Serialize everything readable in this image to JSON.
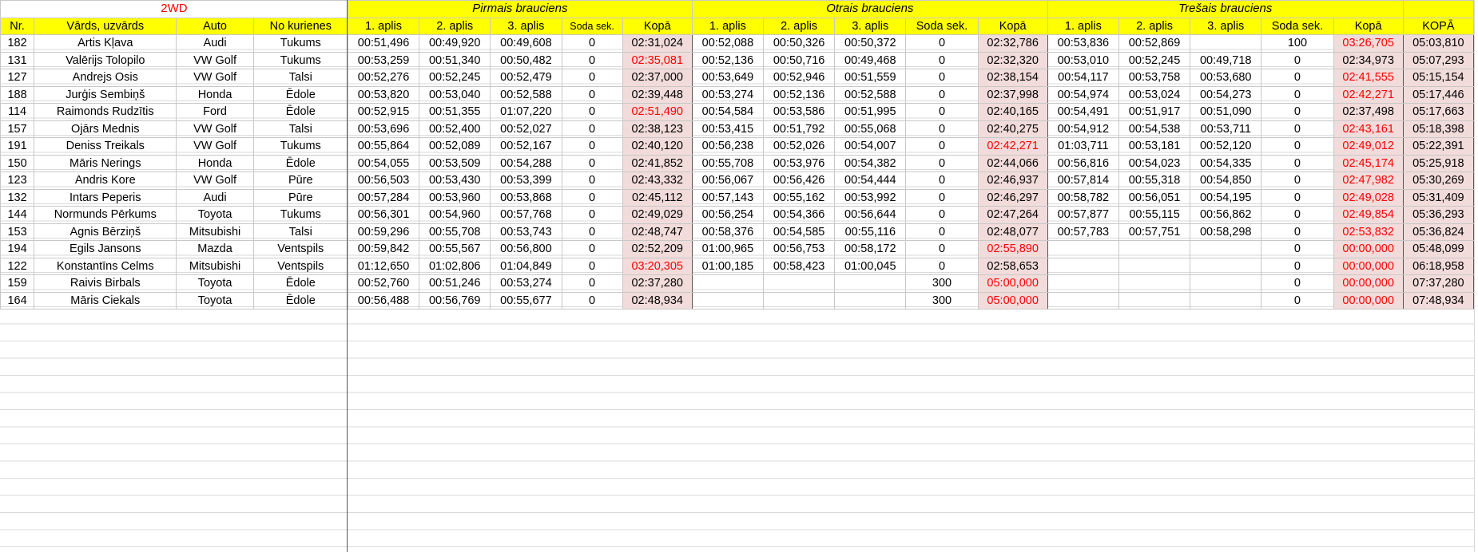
{
  "sheet_title": "2WD",
  "heats": [
    "Pirmais brauciens",
    "Otrais brauciens",
    "Trešais brauciens"
  ],
  "headers": {
    "nr": "Nr.",
    "name": "Vārds, uzvārds",
    "car": "Auto",
    "from": "No kurienes",
    "lap1": "1. aplis",
    "lap2": "2. aplis",
    "lap3": "3. aplis",
    "penalty": "Soda sek.",
    "total": "Kopā",
    "grand_total": "KOPĀ"
  },
  "rows": [
    {
      "nr": "182",
      "name": "Artis Kļava",
      "car": "Audi",
      "from": "Tukums",
      "h1": {
        "l1": "00:51,496",
        "l2": "00:49,920",
        "l3": "00:49,608",
        "pen": "0",
        "tot": "02:31,024"
      },
      "h2": {
        "l1": "00:52,088",
        "l2": "00:50,326",
        "l3": "00:50,372",
        "pen": "0",
        "tot": "02:32,786"
      },
      "h3": {
        "l1": "00:53,836",
        "l2": "00:52,869",
        "l3": "",
        "pen": "100",
        "tot": "03:26,705"
      },
      "grand": "05:03,810"
    },
    {
      "nr": "131",
      "name": "Valērijs Tolopilo",
      "car": "VW Golf",
      "from": "Tukums",
      "h1": {
        "l1": "00:53,259",
        "l2": "00:51,340",
        "l3": "00:50,482",
        "pen": "0",
        "tot": "02:35,081"
      },
      "h2": {
        "l1": "00:52,136",
        "l2": "00:50,716",
        "l3": "00:49,468",
        "pen": "0",
        "tot": "02:32,320"
      },
      "h3": {
        "l1": "00:53,010",
        "l2": "00:52,245",
        "l3": "00:49,718",
        "pen": "0",
        "tot": "02:34,973"
      },
      "grand": "05:07,293"
    },
    {
      "nr": "127",
      "name": "Andrejs Osis",
      "car": "VW Golf",
      "from": "Talsi",
      "h1": {
        "l1": "00:52,276",
        "l2": "00:52,245",
        "l3": "00:52,479",
        "pen": "0",
        "tot": "02:37,000"
      },
      "h2": {
        "l1": "00:53,649",
        "l2": "00:52,946",
        "l3": "00:51,559",
        "pen": "0",
        "tot": "02:38,154"
      },
      "h3": {
        "l1": "00:54,117",
        "l2": "00:53,758",
        "l3": "00:53,680",
        "pen": "0",
        "tot": "02:41,555"
      },
      "grand": "05:15,154"
    },
    {
      "nr": "188",
      "name": "Jurģis Sembiņš",
      "car": "Honda",
      "from": "Ēdole",
      "h1": {
        "l1": "00:53,820",
        "l2": "00:53,040",
        "l3": "00:52,588",
        "pen": "0",
        "tot": "02:39,448"
      },
      "h2": {
        "l1": "00:53,274",
        "l2": "00:52,136",
        "l3": "00:52,588",
        "pen": "0",
        "tot": "02:37,998"
      },
      "h3": {
        "l1": "00:54,974",
        "l2": "00:53,024",
        "l3": "00:54,273",
        "pen": "0",
        "tot": "02:42,271"
      },
      "grand": "05:17,446"
    },
    {
      "nr": "114",
      "name": "Raimonds Rudzītis",
      "car": "Ford",
      "from": "Ēdole",
      "h1": {
        "l1": "00:52,915",
        "l2": "00:51,355",
        "l3": "01:07,220",
        "pen": "0",
        "tot": "02:51,490"
      },
      "h2": {
        "l1": "00:54,584",
        "l2": "00:53,586",
        "l3": "00:51,995",
        "pen": "0",
        "tot": "02:40,165"
      },
      "h3": {
        "l1": "00:54,491",
        "l2": "00:51,917",
        "l3": "00:51,090",
        "pen": "0",
        "tot": "02:37,498"
      },
      "grand": "05:17,663"
    },
    {
      "nr": "157",
      "name": "Ojārs Mednis",
      "car": "VW Golf",
      "from": "Talsi",
      "h1": {
        "l1": "00:53,696",
        "l2": "00:52,400",
        "l3": "00:52,027",
        "pen": "0",
        "tot": "02:38,123"
      },
      "h2": {
        "l1": "00:53,415",
        "l2": "00:51,792",
        "l3": "00:55,068",
        "pen": "0",
        "tot": "02:40,275"
      },
      "h3": {
        "l1": "00:54,912",
        "l2": "00:54,538",
        "l3": "00:53,711",
        "pen": "0",
        "tot": "02:43,161"
      },
      "grand": "05:18,398"
    },
    {
      "nr": "191",
      "name": "Deniss Treikals",
      "car": "VW Golf",
      "from": "Tukums",
      "h1": {
        "l1": "00:55,864",
        "l2": "00:52,089",
        "l3": "00:52,167",
        "pen": "0",
        "tot": "02:40,120"
      },
      "h2": {
        "l1": "00:56,238",
        "l2": "00:52,026",
        "l3": "00:54,007",
        "pen": "0",
        "tot": "02:42,271"
      },
      "h3": {
        "l1": "01:03,711",
        "l2": "00:53,181",
        "l3": "00:52,120",
        "pen": "0",
        "tot": "02:49,012"
      },
      "grand": "05:22,391"
    },
    {
      "nr": "150",
      "name": "Māris Nerings",
      "car": "Honda",
      "from": "Ēdole",
      "h1": {
        "l1": "00:54,055",
        "l2": "00:53,509",
        "l3": "00:54,288",
        "pen": "0",
        "tot": "02:41,852"
      },
      "h2": {
        "l1": "00:55,708",
        "l2": "00:53,976",
        "l3": "00:54,382",
        "pen": "0",
        "tot": "02:44,066"
      },
      "h3": {
        "l1": "00:56,816",
        "l2": "00:54,023",
        "l3": "00:54,335",
        "pen": "0",
        "tot": "02:45,174"
      },
      "grand": "05:25,918"
    },
    {
      "nr": "123",
      "name": "Andris Kore",
      "car": "VW Golf",
      "from": "Pūre",
      "h1": {
        "l1": "00:56,503",
        "l2": "00:53,430",
        "l3": "00:53,399",
        "pen": "0",
        "tot": "02:43,332"
      },
      "h2": {
        "l1": "00:56,067",
        "l2": "00:56,426",
        "l3": "00:54,444",
        "pen": "0",
        "tot": "02:46,937"
      },
      "h3": {
        "l1": "00:57,814",
        "l2": "00:55,318",
        "l3": "00:54,850",
        "pen": "0",
        "tot": "02:47,982"
      },
      "grand": "05:30,269"
    },
    {
      "nr": "132",
      "name": "Intars Peperis",
      "car": "Audi",
      "from": "Pūre",
      "h1": {
        "l1": "00:57,284",
        "l2": "00:53,960",
        "l3": "00:53,868",
        "pen": "0",
        "tot": "02:45,112"
      },
      "h2": {
        "l1": "00:57,143",
        "l2": "00:55,162",
        "l3": "00:53,992",
        "pen": "0",
        "tot": "02:46,297"
      },
      "h3": {
        "l1": "00:58,782",
        "l2": "00:56,051",
        "l3": "00:54,195",
        "pen": "0",
        "tot": "02:49,028"
      },
      "grand": "05:31,409"
    },
    {
      "nr": "144",
      "name": "Normunds Pērkums",
      "car": "Toyota",
      "from": "Tukums",
      "h1": {
        "l1": "00:56,301",
        "l2": "00:54,960",
        "l3": "00:57,768",
        "pen": "0",
        "tot": "02:49,029"
      },
      "h2": {
        "l1": "00:56,254",
        "l2": "00:54,366",
        "l3": "00:56,644",
        "pen": "0",
        "tot": "02:47,264"
      },
      "h3": {
        "l1": "00:57,877",
        "l2": "00:55,115",
        "l3": "00:56,862",
        "pen": "0",
        "tot": "02:49,854"
      },
      "grand": "05:36,293"
    },
    {
      "nr": "153",
      "name": "Agnis Bērziņš",
      "car": "Mitsubishi",
      "from": "Talsi",
      "h1": {
        "l1": "00:59,296",
        "l2": "00:55,708",
        "l3": "00:53,743",
        "pen": "0",
        "tot": "02:48,747"
      },
      "h2": {
        "l1": "00:58,376",
        "l2": "00:54,585",
        "l3": "00:55,116",
        "pen": "0",
        "tot": "02:48,077"
      },
      "h3": {
        "l1": "00:57,783",
        "l2": "00:57,751",
        "l3": "00:58,298",
        "pen": "0",
        "tot": "02:53,832"
      },
      "grand": "05:36,824"
    },
    {
      "nr": "194",
      "name": "Egils Jansons",
      "car": "Mazda",
      "from": "Ventspils",
      "h1": {
        "l1": "00:59,842",
        "l2": "00:55,567",
        "l3": "00:56,800",
        "pen": "0",
        "tot": "02:52,209"
      },
      "h2": {
        "l1": "01:00,965",
        "l2": "00:56,753",
        "l3": "00:58,172",
        "pen": "0",
        "tot": "02:55,890"
      },
      "h3": {
        "l1": "",
        "l2": "",
        "l3": "",
        "pen": "0",
        "tot": "00:00,000"
      },
      "grand": "05:48,099"
    },
    {
      "nr": "122",
      "name": "Konstantīns Celms",
      "car": "Mitsubishi",
      "from": "Ventspils",
      "h1": {
        "l1": "01:12,650",
        "l2": "01:02,806",
        "l3": "01:04,849",
        "pen": "0",
        "tot": "03:20,305"
      },
      "h2": {
        "l1": "01:00,185",
        "l2": "00:58,423",
        "l3": "01:00,045",
        "pen": "0",
        "tot": "02:58,653"
      },
      "h3": {
        "l1": "",
        "l2": "",
        "l3": "",
        "pen": "0",
        "tot": "00:00,000"
      },
      "grand": "06:18,958"
    },
    {
      "nr": "159",
      "name": "Raivis Birbals",
      "car": "Toyota",
      "from": "Ēdole",
      "h1": {
        "l1": "00:52,760",
        "l2": "00:51,246",
        "l3": "00:53,274",
        "pen": "0",
        "tot": "02:37,280"
      },
      "h2": {
        "l1": "",
        "l2": "",
        "l3": "",
        "pen": "300",
        "tot": "05:00,000"
      },
      "h3": {
        "l1": "",
        "l2": "",
        "l3": "",
        "pen": "0",
        "tot": "00:00,000"
      },
      "grand": "07:37,280"
    },
    {
      "nr": "164",
      "name": "Māris Ciekals",
      "car": "Toyota",
      "from": "Ēdole",
      "h1": {
        "l1": "00:56,488",
        "l2": "00:56,769",
        "l3": "00:55,677",
        "pen": "0",
        "tot": "02:48,934"
      },
      "h2": {
        "l1": "",
        "l2": "",
        "l3": "",
        "pen": "300",
        "tot": "05:00,000"
      },
      "h3": {
        "l1": "",
        "l2": "",
        "l3": "",
        "pen": "0",
        "tot": "00:00,000"
      },
      "grand": "07:48,934"
    }
  ],
  "highlights": {
    "best_lap": [
      [
        "l3",
        "l2",
        "l2"
      ],
      [
        "l3",
        "l3",
        "l3"
      ],
      [
        "l2",
        "l3",
        "l3"
      ],
      [
        "l3",
        "l2",
        "l2"
      ],
      [
        "l2",
        "l3",
        "l3"
      ],
      [
        "l3",
        "l2",
        "l3"
      ],
      [
        "l2",
        "l2",
        "l3"
      ],
      [
        "l2",
        "l2",
        "l2"
      ],
      [
        "l3",
        "l3",
        "l3"
      ],
      [
        "l3",
        "l3",
        "l3"
      ],
      [
        "l2",
        "l2",
        "l2"
      ],
      [
        "l3",
        "l2",
        "l2"
      ],
      [
        "l2",
        "l2",
        ""
      ],
      [
        "l2",
        "l2",
        ""
      ],
      [
        "l2",
        "",
        ""
      ],
      [
        "l3",
        "",
        ""
      ]
    ],
    "red_totals": [
      [
        false,
        false,
        true
      ],
      [
        true,
        false,
        false
      ],
      [
        false,
        false,
        true
      ],
      [
        false,
        false,
        true
      ],
      [
        true,
        false,
        false
      ],
      [
        false,
        false,
        true
      ],
      [
        false,
        true,
        true
      ],
      [
        false,
        false,
        true
      ],
      [
        false,
        false,
        true
      ],
      [
        false,
        false,
        true
      ],
      [
        false,
        false,
        true
      ],
      [
        false,
        false,
        true
      ],
      [
        false,
        true,
        true
      ],
      [
        true,
        false,
        true
      ],
      [
        false,
        true,
        true
      ],
      [
        false,
        true,
        true
      ]
    ]
  },
  "colors": {
    "header_bg": "#ffff00",
    "total_bg": "#f2dcdb",
    "red_text": "#ff0000"
  }
}
